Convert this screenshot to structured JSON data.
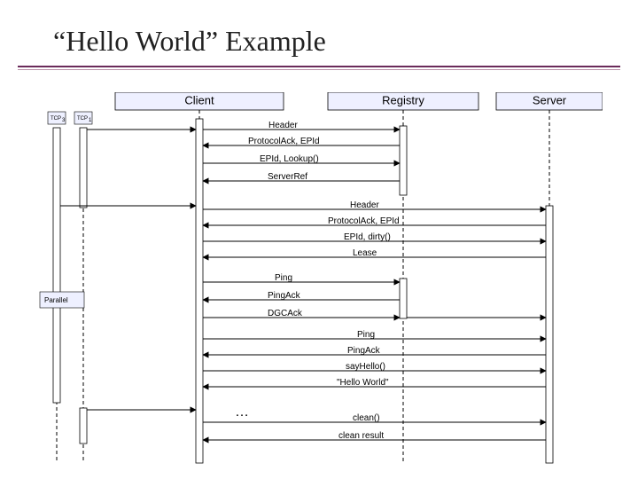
{
  "title": "“Hello World” Example",
  "lanes": {
    "client": "Client",
    "registry": "Registry",
    "server": "Server"
  },
  "tcp": {
    "a": "TCP",
    "aSub": "3",
    "b": "TCP",
    "bSub": "1"
  },
  "parallel": "Parallel",
  "ellipsis": "…",
  "msgs": {
    "m1": "Header",
    "m2": "ProtocolAck, EPId",
    "m3": "EPId, Lookup()",
    "m4": "ServerRef",
    "m5": "Header",
    "m6": "ProtocolAck, EPId",
    "m7": "EPId, dirty()",
    "m8": "Lease",
    "m9": "Ping",
    "m10": "PingAck",
    "m11": "DGCAck",
    "m12": "Ping",
    "m13": "PingAck",
    "m14": "sayHello()",
    "m15": "\"Hello World\"",
    "m16": "clean()",
    "m17": "clean result"
  }
}
